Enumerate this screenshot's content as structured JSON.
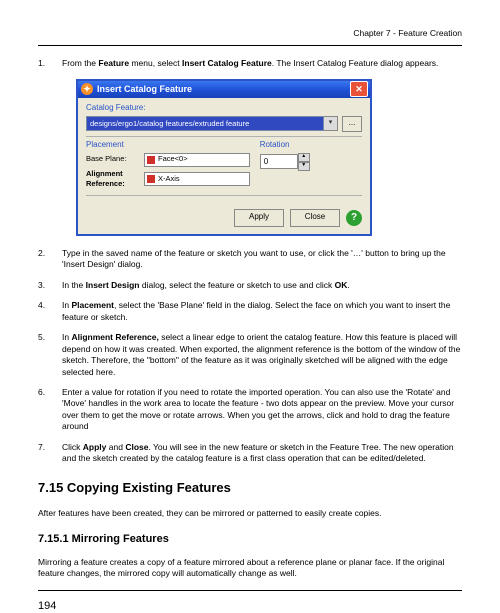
{
  "chapter_header": "Chapter 7 - Feature Creation",
  "step1_a": "1.",
  "step1_b": "From the ",
  "step1_c": "Feature",
  "step1_d": " menu, select ",
  "step1_e": "Insert Catalog Feature",
  "step1_f": ". The Insert Catalog Feature dialog appears.",
  "dialog": {
    "title": "Insert Catalog Feature",
    "close_glyph": "✕",
    "catalog_label": "Catalog Feature:",
    "catalog_value": "designs/ergo1/catalog features/extruded feature",
    "browse_label": "...",
    "placement_label": "Placement",
    "base_plane_label": "Base Plane:",
    "base_plane_value": "Face<0>",
    "align_ref_label1": "Alignment",
    "align_ref_label2": "Reference:",
    "align_ref_value": "X-Axis",
    "rotation_label": "Rotation",
    "rotation_value": "0",
    "apply": "Apply",
    "close": "Close",
    "help_glyph": "?"
  },
  "step2_a": "2.",
  "step2_b": "Type in the saved name of the feature or sketch you want to use, or click the '…' button to bring up the 'Insert Design' dialog.",
  "step3_a": "3.",
  "step3_b": "In the ",
  "step3_c": "Insert Design",
  "step3_d": " dialog, select the feature or sketch to use and click ",
  "step3_e": "OK",
  "step3_f": ".",
  "step4_a": "4.",
  "step4_b": "In ",
  "step4_c": "Placement",
  "step4_d": ", select the 'Base Plane' field in the dialog. Select the face on which you want to insert the feature or sketch.",
  "step5_a": "5.",
  "step5_b": "In ",
  "step5_c": "Alignment Reference,",
  "step5_d": " select a linear edge to orient the catalog feature. How this feature is placed will depend on how it was created. When exported, the alignment reference is the bottom of the window of the sketch. Therefore, the \"bottom\" of the feature as it was originally sketched will be aligned with the edge selected here.",
  "step6_a": "6.",
  "step6_b": "Enter a value for rotation if you need to rotate the imported operation. You can also use the 'Rotate' and 'Move' handles in the work area to locate the feature - two dots appear on the preview. Move your cursor over them to get the move or rotate arrows. When you get the arrows, click and hold to drag the feature around",
  "step7_a": "7.",
  "step7_b": "Click ",
  "step7_c": "Apply",
  "step7_d": " and ",
  "step7_e": "Close",
  "step7_f": ". You will see in the new feature or sketch in the Feature Tree. The new operation and the sketch created by the catalog feature is a first class operation that can be edited/deleted.",
  "sec_715": "7.15    Copying Existing Features",
  "body_715": "After features have been created, they can be mirrored or patterned to easily create copies.",
  "sec_7151": "7.15.1    Mirroring Features",
  "body_7151": "Mirroring a feature creates a copy of a feature mirrored about a reference plane or planar face. If the original feature changes, the mirrored copy will automatically change as well.",
  "page_number": "194"
}
